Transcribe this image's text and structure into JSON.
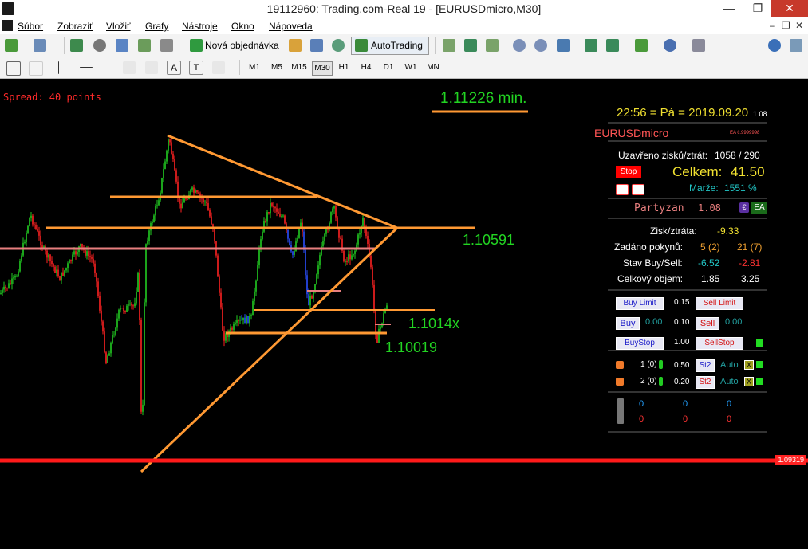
{
  "window": {
    "title": "19112960: Trading.com-Real 19 - [EURUSDmicro,M30]"
  },
  "menu": {
    "items": [
      "Súbor",
      "Zobraziť",
      "Vložiť",
      "Grafy",
      "Nástroje",
      "Okno",
      "Nápoveda"
    ]
  },
  "toolbar": {
    "new_order": "Nová objednávka",
    "autotrading": "AutoTrading"
  },
  "timeframes": [
    "M1",
    "M5",
    "M15",
    "M30",
    "H1",
    "H4",
    "D1",
    "W1",
    "MN"
  ],
  "active_timeframe": "M30",
  "chart": {
    "spread": "Spread: 40 points",
    "min_label": "1.11226 min.",
    "levels": {
      "l1": "1.10591",
      "l2": "1.1014x",
      "l3": "1.10019"
    },
    "current_price": "1.09319"
  },
  "panel": {
    "clock": "22:56 = Pá = 2019.09.20",
    "version_small": "1.08",
    "symbol": "EURUSDmicro",
    "ea_id": "EA č.9999998",
    "closed_label": "Uzavřeno zisků/ztrát:",
    "closed_value": "1058 / 290",
    "stop": "Stop",
    "total_label": "Celkem:",
    "total_value": "41.50",
    "margin_label": "Marže:",
    "margin_value": "1551 %",
    "partyzan": "Partyzan",
    "partyzan_ver": "1.08",
    "ea_badge": "EA",
    "pl_label": "Zisk/ztráta:",
    "pl_value": "-9.33",
    "orders_label": "Zadáno pokynů:",
    "orders_buy": "5 (2)",
    "orders_sell": "21 (7)",
    "state_label": "Stav Buy/Sell:",
    "state_buy": "-6.52",
    "state_sell": "-2.81",
    "volume_label": "Celkový objem:",
    "volume_buy": "1.85",
    "volume_sell": "3.25",
    "buy_limit": "Buy Limit",
    "limit_lot": "0.15",
    "sell_limit": "Sell Limit",
    "buy": "Buy",
    "buy_val": "0.00",
    "lot": "0.10",
    "sell": "Sell",
    "sell_val": "0.00",
    "buystop": "BuyStop",
    "stop_lot": "1.00",
    "sellstop": "SellStop",
    "row1_label": "1 (0)",
    "row1_val": "0.50",
    "row2_label": "2 (0)",
    "row2_val": "0.20",
    "st2": "St2",
    "auto": "Auto",
    "x": "X",
    "zero": "0"
  },
  "colors": {
    "bull": "#22cc22",
    "bear": "#ff2222",
    "orange": "#ff9933",
    "pink": "#e87f7f"
  }
}
